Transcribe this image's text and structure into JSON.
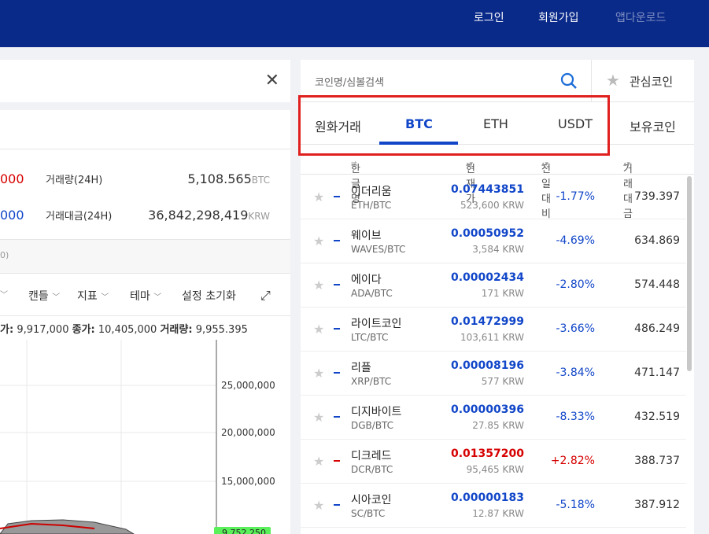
{
  "topbar": {
    "login": "로그인",
    "signup": "회원가입",
    "app_download": "앱다운로드"
  },
  "left": {
    "stats": [
      {
        "price": "000",
        "price_color": "#d60000",
        "label": "거래량(24H)",
        "value": "5,108.565",
        "unit": "BTC"
      },
      {
        "price": "000",
        "price_color": "#1146c9",
        "label": "거래대금(24H)",
        "value": "36,842,298,419",
        "unit": "KRW"
      }
    ],
    "strip_text": "0)",
    "toolbar": {
      "candle": "캔들",
      "indicator": "지표",
      "theme": "테마",
      "reset": "설정 초기화"
    },
    "ohlc": {
      "low_label": "가:",
      "low_value": "9,917,000",
      "close_label": "종가:",
      "close_value": "10,405,000",
      "volume_label": "거래량:",
      "volume_value": "9,955.395"
    },
    "chart_axis": [
      "25,000,000",
      "20,000,000",
      "15,000,000"
    ],
    "chart_last": "9,752,250"
  },
  "right": {
    "search_placeholder": "코인명/심볼검색",
    "favorites": "관심코인",
    "tabs": [
      "원화거래",
      "BTC",
      "ETH",
      "USDT",
      "보유코인"
    ],
    "active_tab": "BTC",
    "columns": {
      "name": "한글명",
      "price": "현재가",
      "change": "전일대비",
      "volume": "거래대금"
    },
    "rows": [
      {
        "name": "이더리움",
        "pair": "ETH/BTC",
        "price": "0.07443851",
        "krw": "523,600 KRW",
        "change": "-1.77%",
        "volume": "739.397",
        "dir": "down"
      },
      {
        "name": "웨이브",
        "pair": "WAVES/BTC",
        "price": "0.00050952",
        "krw": "3,584 KRW",
        "change": "-4.69%",
        "volume": "634.869",
        "dir": "down"
      },
      {
        "name": "에이다",
        "pair": "ADA/BTC",
        "price": "0.00002434",
        "krw": "171 KRW",
        "change": "-2.80%",
        "volume": "574.448",
        "dir": "down"
      },
      {
        "name": "라이트코인",
        "pair": "LTC/BTC",
        "price": "0.01472999",
        "krw": "103,611 KRW",
        "change": "-3.66%",
        "volume": "486.249",
        "dir": "down"
      },
      {
        "name": "리플",
        "pair": "XRP/BTC",
        "price": "0.00008196",
        "krw": "577 KRW",
        "change": "-3.84%",
        "volume": "471.147",
        "dir": "down"
      },
      {
        "name": "디지바이트",
        "pair": "DGB/BTC",
        "price": "0.00000396",
        "krw": "27.85 KRW",
        "change": "-8.33%",
        "volume": "432.519",
        "dir": "down"
      },
      {
        "name": "디크레드",
        "pair": "DCR/BTC",
        "price": "0.01357200",
        "krw": "95,465 KRW",
        "change": "+2.82%",
        "volume": "388.737",
        "dir": "up"
      },
      {
        "name": "시아코인",
        "pair": "SC/BTC",
        "price": "0.00000183",
        "krw": "12.87 KRW",
        "change": "-5.18%",
        "volume": "387.912",
        "dir": "down"
      }
    ]
  },
  "colors": {
    "up": "#d60000",
    "down": "#1146c9",
    "brand": "#0a2a8a",
    "highlight": "#e0201f"
  }
}
